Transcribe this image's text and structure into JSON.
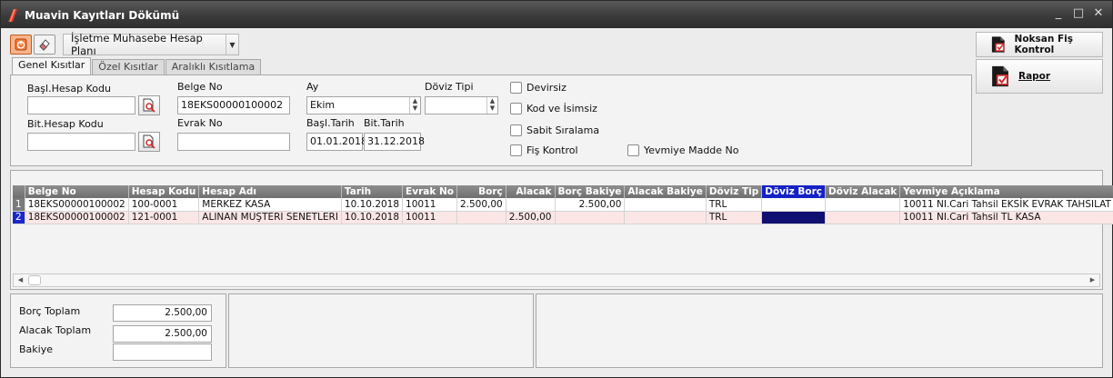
{
  "window": {
    "title": "Muavin Kayıtları Dökümü"
  },
  "toolbar": {
    "plan_label": "İşletme Muhasebe Hesap Planı"
  },
  "side": {
    "noksan_label": "Noksan Fiş Kontrol",
    "rapor_label": "Rapor"
  },
  "tabs": [
    {
      "label": "Genel Kısıtlar"
    },
    {
      "label": "Özel Kısıtlar"
    },
    {
      "label": "Aralıklı Kısıtlama"
    }
  ],
  "filters": {
    "basl_hesap_label": "Başl.Hesap Kodu",
    "bit_hesap_label": "Bit.Hesap Kodu",
    "belge_no_label": "Belge No",
    "belge_no_value": "18EKS00000100002",
    "evrak_no_label": "Evrak No",
    "ay_label": "Ay",
    "ay_value": "Ekim",
    "doviz_tipi_label": "Döviz Tipi",
    "basl_tarih_label": "Başl.Tarih",
    "basl_tarih_value": "01.01.2018",
    "bit_tarih_label": "Bit.Tarih",
    "bit_tarih_value": "31.12.2018",
    "chk_devirsiz": "Devirsiz",
    "chk_kod_isimsiz": "Kod ve İsimsiz",
    "chk_sabit": "Sabit Sıralama",
    "chk_fis_kontrol": "Fiş Kontrol",
    "chk_yevmiye": "Yevmiye Madde No"
  },
  "grid": {
    "headers": {
      "belge_no": "Belge No",
      "hesap_kodu": "Hesap Kodu",
      "hesap_adi": "Hesap Adı",
      "tarih": "Tarih",
      "evrak_no": "Evrak No",
      "borc": "Borç",
      "alacak": "Alacak",
      "borc_bakiye": "Borç Bakiye",
      "alacak_bakiye": "Alacak Bakiye",
      "doviz_tip": "Döviz Tip",
      "doviz_borc": "Döviz Borç",
      "doviz_alacak": "Döviz Alacak",
      "yevmiye_aciklama": "Yevmiye Açıklama"
    },
    "rows": [
      {
        "num": "1",
        "belge_no": "18EKS00000100002",
        "hesap_kodu": "100-0001",
        "hesap_adi": "MERKEZ KASA",
        "tarih": "10.10.2018",
        "evrak_no": "10011",
        "borc": "2.500,00",
        "alacak": "",
        "borc_bakiye": "2.500,00",
        "alacak_bakiye": "",
        "doviz_tip": "TRL",
        "doviz_borc": "",
        "doviz_alacak": "",
        "yevmiye_aciklama": "10011 NI.Cari Tahsil EKSİK EVRAK TAHSILAT"
      },
      {
        "num": "2",
        "belge_no": "18EKS00000100002",
        "hesap_kodu": "121-0001",
        "hesap_adi": "ALINAN MÜŞTERİ SENETLERİ",
        "tarih": "10.10.2018",
        "evrak_no": "10011",
        "borc": "",
        "alacak": "2.500,00",
        "borc_bakiye": "",
        "alacak_bakiye": "",
        "doviz_tip": "TRL",
        "doviz_borc": "",
        "doviz_alacak": "",
        "yevmiye_aciklama": "10011 NI.Cari Tahsil TL KASA"
      }
    ]
  },
  "totals": {
    "borc_label": "Borç Toplam",
    "borc_value": "2.500,00",
    "alacak_label": "Alacak Toplam",
    "alacak_value": "2.500,00",
    "bakiye_label": "Bakiye",
    "bakiye_value": ""
  },
  "colors": {
    "accent": "#1522c6",
    "selected_row": "#fbe6e6",
    "title_bar": "#3b3b3b"
  }
}
